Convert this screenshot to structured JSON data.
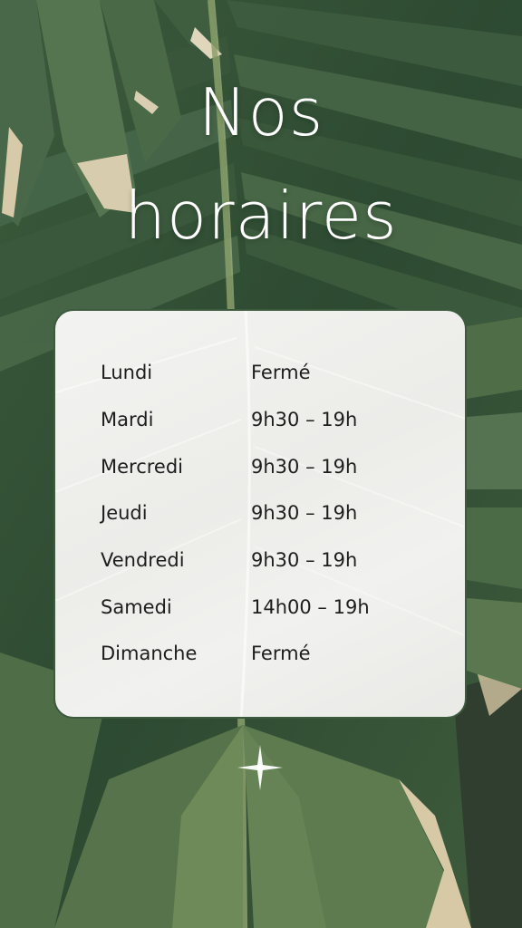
{
  "title": {
    "line1": "Nos",
    "line2": "horaires"
  },
  "schedule": [
    {
      "day": "Lundi",
      "hours": "Fermé"
    },
    {
      "day": "Mardi",
      "hours": "9h30 – 19h"
    },
    {
      "day": "Mercredi",
      "hours": "9h30 – 19h"
    },
    {
      "day": "Jeudi",
      "hours": "9h30 – 19h"
    },
    {
      "day": "Vendredi",
      "hours": "9h30 – 19h"
    },
    {
      "day": "Samedi",
      "hours": "14h00 – 19h"
    },
    {
      "day": "Dimanche",
      "hours": "Fermé"
    }
  ],
  "colors": {
    "leaf_dark": "#2b4530",
    "leaf_mid": "#4d6b47",
    "card_border": "#3c5a3e",
    "text": "#1d1d1d",
    "title": "#ffffff"
  },
  "decor": {
    "sparkle_icon": "sparkle-icon",
    "background": "palm-leaf-photo"
  }
}
